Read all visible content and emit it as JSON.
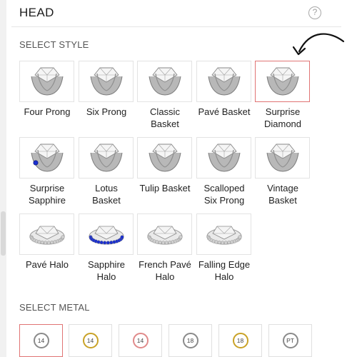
{
  "header": {
    "title": "HEAD",
    "help_icon_glyph": "?"
  },
  "style_section": {
    "label": "SELECT STYLE"
  },
  "styles": [
    {
      "name": "four-prong",
      "lines": [
        "Four Prong",
        ""
      ],
      "selected": false,
      "icon": "ring-head-four-prong"
    },
    {
      "name": "six-prong",
      "lines": [
        "Six Prong",
        ""
      ],
      "selected": false,
      "icon": "ring-head-six-prong"
    },
    {
      "name": "classic-basket",
      "lines": [
        "Classic",
        "Basket"
      ],
      "selected": false,
      "icon": "ring-head-classic-basket"
    },
    {
      "name": "pave-basket",
      "lines": [
        "Pavé Basket",
        ""
      ],
      "selected": false,
      "icon": "ring-head-pave-basket"
    },
    {
      "name": "surprise-diamond",
      "lines": [
        "Surprise",
        "Diamond"
      ],
      "selected": true,
      "icon": "ring-head-surprise-diamond"
    },
    {
      "name": "surprise-sapphire",
      "lines": [
        "Surprise",
        "Sapphire"
      ],
      "selected": false,
      "icon": "ring-head-surprise-sapphire"
    },
    {
      "name": "lotus-basket",
      "lines": [
        "Lotus",
        "Basket"
      ],
      "selected": false,
      "icon": "ring-head-lotus-basket"
    },
    {
      "name": "tulip-basket",
      "lines": [
        "Tulip Basket",
        ""
      ],
      "selected": false,
      "icon": "ring-head-tulip-basket"
    },
    {
      "name": "scalloped-six-prong",
      "lines": [
        "Scalloped",
        "Six Prong"
      ],
      "selected": false,
      "icon": "ring-head-scalloped-six-prong"
    },
    {
      "name": "vintage-basket",
      "lines": [
        "Vintage",
        "Basket"
      ],
      "selected": false,
      "icon": "ring-head-vintage-basket"
    },
    {
      "name": "pave-halo",
      "lines": [
        "Pavé Halo",
        ""
      ],
      "selected": false,
      "icon": "ring-head-pave-halo"
    },
    {
      "name": "sapphire-halo",
      "lines": [
        "Sapphire",
        "Halo"
      ],
      "selected": false,
      "icon": "ring-head-sapphire-halo"
    },
    {
      "name": "french-pave-halo",
      "lines": [
        "French Pavé",
        "Halo"
      ],
      "selected": false,
      "icon": "ring-head-french-pave-halo"
    },
    {
      "name": "falling-edge-halo",
      "lines": [
        "Falling Edge",
        "Halo"
      ],
      "selected": false,
      "icon": "ring-head-falling-edge-halo"
    }
  ],
  "metal_section": {
    "label": "SELECT METAL"
  },
  "metals": [
    {
      "label": "14",
      "ring_color": "#8a8a8a",
      "selected": true
    },
    {
      "label": "14",
      "ring_color": "#c9a227",
      "selected": false
    },
    {
      "label": "14",
      "ring_color": "#e08a8a",
      "selected": false
    },
    {
      "label": "18",
      "ring_color": "#8a8a8a",
      "selected": false
    },
    {
      "label": "18",
      "ring_color": "#c9a227",
      "selected": false
    },
    {
      "label": "PT",
      "ring_color": "#8a8a8a",
      "selected": false
    }
  ],
  "colors": {
    "selected_border": "#e07474",
    "tile_border": "#e3e3e3",
    "sapphire_blue": "#1a2fd0",
    "metal_silver": "#b8b8b8"
  }
}
